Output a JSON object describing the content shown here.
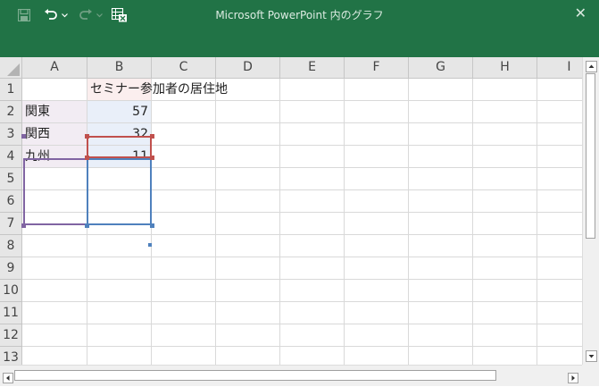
{
  "window": {
    "title": "Microsoft PowerPoint 内のグラフ",
    "close_glyph": "✕",
    "accent_color": "#217346"
  },
  "toolbar": {
    "save_icon": "save-icon",
    "undo_icon": "undo-icon",
    "redo_icon": "redo-icon",
    "excel_icon": "edit-in-excel-icon"
  },
  "sheet": {
    "columns": [
      "A",
      "B",
      "C",
      "D",
      "E",
      "F",
      "G",
      "H",
      "I"
    ],
    "rows": [
      "1",
      "2",
      "3",
      "4",
      "5",
      "6",
      "7",
      "8",
      "9",
      "10",
      "11",
      "12",
      "13"
    ],
    "cells": {
      "B1": "セミナー参加者の居住地",
      "A2": "関東",
      "B2": "57",
      "A3": "関西",
      "B3": "32",
      "A4": "九州",
      "B4": "11"
    },
    "range_colors": {
      "series_name": "#c0504d",
      "values": "#4f81bd",
      "categories": "#8064a2"
    }
  }
}
